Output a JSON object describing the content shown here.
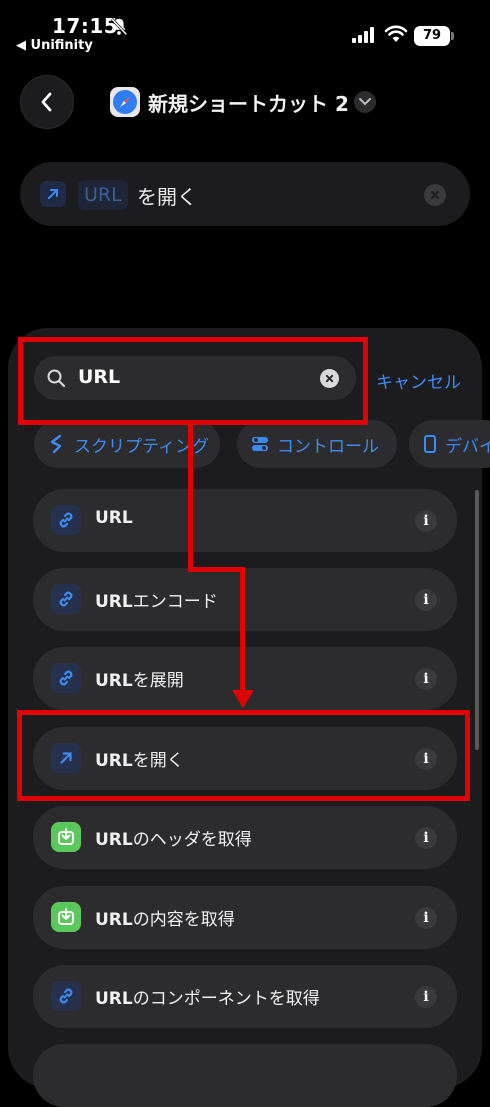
{
  "status": {
    "time": "17:15",
    "back_app": "◀ Unifinity",
    "battery": "79"
  },
  "nav": {
    "title": "新規ショートカット 2"
  },
  "action": {
    "token": "URL",
    "suffix": "を開く"
  },
  "search": {
    "query": "URL",
    "cancel_label": "キャンセル"
  },
  "categories": [
    {
      "label": "スクリプティング"
    },
    {
      "label": "コントロール"
    },
    {
      "label": "デバイス"
    }
  ],
  "results": [
    {
      "prefix": "URL",
      "suffix": "",
      "icon": "link-icon",
      "color": "blue"
    },
    {
      "prefix": "URL",
      "suffix": "エンコード",
      "icon": "link-icon",
      "color": "blue"
    },
    {
      "prefix": "URL",
      "suffix": "を展開",
      "icon": "link-icon",
      "color": "blue"
    },
    {
      "prefix": "URL",
      "suffix": "を開く",
      "icon": "arrow-up-right-icon",
      "color": "blue"
    },
    {
      "prefix": "URL",
      "suffix": "のヘッダを取得",
      "icon": "download-icon",
      "color": "green"
    },
    {
      "prefix": "URL",
      "suffix": "の内容を取得",
      "icon": "download-icon",
      "color": "green"
    },
    {
      "prefix": "URL",
      "suffix": "のコンポーネントを取得",
      "icon": "link-icon",
      "color": "blue"
    }
  ],
  "info_glyph": "i",
  "colors": {
    "accent": "#3b8cf2",
    "annotation": "#e00000",
    "green": "#5ac85a"
  }
}
